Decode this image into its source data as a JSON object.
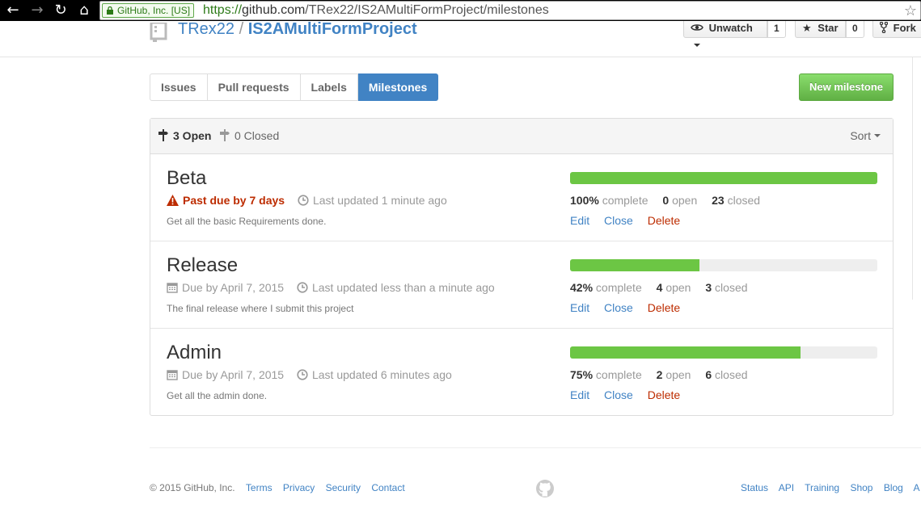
{
  "browser": {
    "ev_label": "GitHub, Inc. [US]",
    "url_scheme": "https://",
    "url_host": "github.com",
    "url_path": "/TRex22/IS2AMultiFormProject/milestones"
  },
  "repo": {
    "owner": "TRex22",
    "separator": "/",
    "name": "IS2AMultiFormProject",
    "unwatch_label": "Unwatch",
    "watch_count": "1",
    "star_label": "Star",
    "star_count": "0",
    "fork_label": "Fork"
  },
  "subnav": {
    "tabs": [
      {
        "label": "Issues",
        "selected": false
      },
      {
        "label": "Pull requests",
        "selected": false
      },
      {
        "label": "Labels",
        "selected": false
      },
      {
        "label": "Milestones",
        "selected": true
      }
    ],
    "new_milestone_label": "New milestone"
  },
  "filters": {
    "open_label": "3 Open",
    "closed_label": "0 Closed",
    "sort_label": "Sort"
  },
  "milestones": [
    {
      "title": "Beta",
      "due_text": "Past due by 7 days",
      "past_due": true,
      "updated": "Last updated 1 minute ago",
      "description": "Get all the basic Requirements done.",
      "percent": 100,
      "percent_label": "100%",
      "complete_label": "complete",
      "open_count": "0",
      "open_label": "open",
      "closed_count": "23",
      "closed_label": "closed"
    },
    {
      "title": "Release",
      "due_text": "Due by April 7, 2015",
      "past_due": false,
      "updated": "Last updated less than a minute ago",
      "description": "The final release where I submit this project",
      "percent": 42,
      "percent_label": "42%",
      "complete_label": "complete",
      "open_count": "4",
      "open_label": "open",
      "closed_count": "3",
      "closed_label": "closed"
    },
    {
      "title": "Admin",
      "due_text": "Due by April 7, 2015",
      "past_due": false,
      "updated": "Last updated 6 minutes ago",
      "description": "Get all the admin done.",
      "percent": 75,
      "percent_label": "75%",
      "complete_label": "complete",
      "open_count": "2",
      "open_label": "open",
      "closed_count": "6",
      "closed_label": "closed"
    }
  ],
  "actions": {
    "edit": "Edit",
    "close": "Close",
    "delete": "Delete"
  },
  "footer": {
    "copyright": "© 2015 GitHub, Inc.",
    "left_links": [
      "Terms",
      "Privacy",
      "Security",
      "Contact"
    ],
    "right_links": [
      "Status",
      "API",
      "Training",
      "Shop",
      "Blog",
      "A"
    ]
  },
  "colors": {
    "link": "#4183c4",
    "progress": "#6cc644",
    "danger": "#bd2c00",
    "new_button": "#60b044"
  },
  "icons": {
    "back": "arrow-left-icon",
    "forward": "arrow-right-icon",
    "reload": "reload-icon",
    "home": "home-icon",
    "lock": "lock-icon",
    "bookmark": "star-outline-icon",
    "repo": "repo-icon",
    "eye": "eye-icon",
    "star": "star-icon",
    "fork": "fork-icon",
    "milestone": "milestone-icon",
    "alert": "alert-icon",
    "calendar": "calendar-icon",
    "clock": "clock-icon",
    "octocat": "octocat-icon"
  }
}
